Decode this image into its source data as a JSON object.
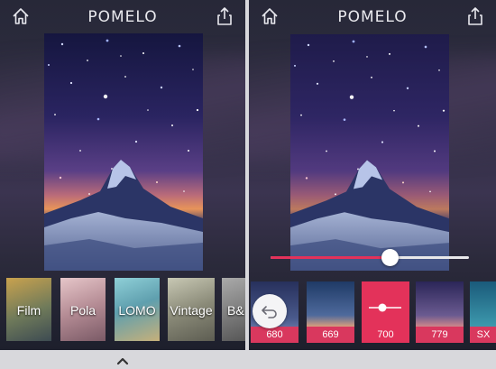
{
  "app": {
    "title": "POMELO"
  },
  "left_panel": {
    "filters": [
      {
        "label": "Film"
      },
      {
        "label": "Pola"
      },
      {
        "label": "LOMO"
      },
      {
        "label": "Vintage"
      },
      {
        "label": "B&"
      }
    ]
  },
  "right_panel": {
    "slider": {
      "value_fraction": 0.6
    },
    "presets": [
      {
        "count": "680"
      },
      {
        "count": "669"
      },
      {
        "count": "700"
      },
      {
        "count": "779"
      },
      {
        "count": "SX"
      }
    ],
    "active_preset_index": 2
  },
  "icons": {
    "home": "home-icon",
    "share": "share-icon",
    "undo": "undo-icon",
    "expand": "chevron-up-icon",
    "adjust": "slider-adjust-icon"
  },
  "colors": {
    "accent": "#e3325a",
    "badge": "#d9385e",
    "bar": "#d8d8dc"
  }
}
